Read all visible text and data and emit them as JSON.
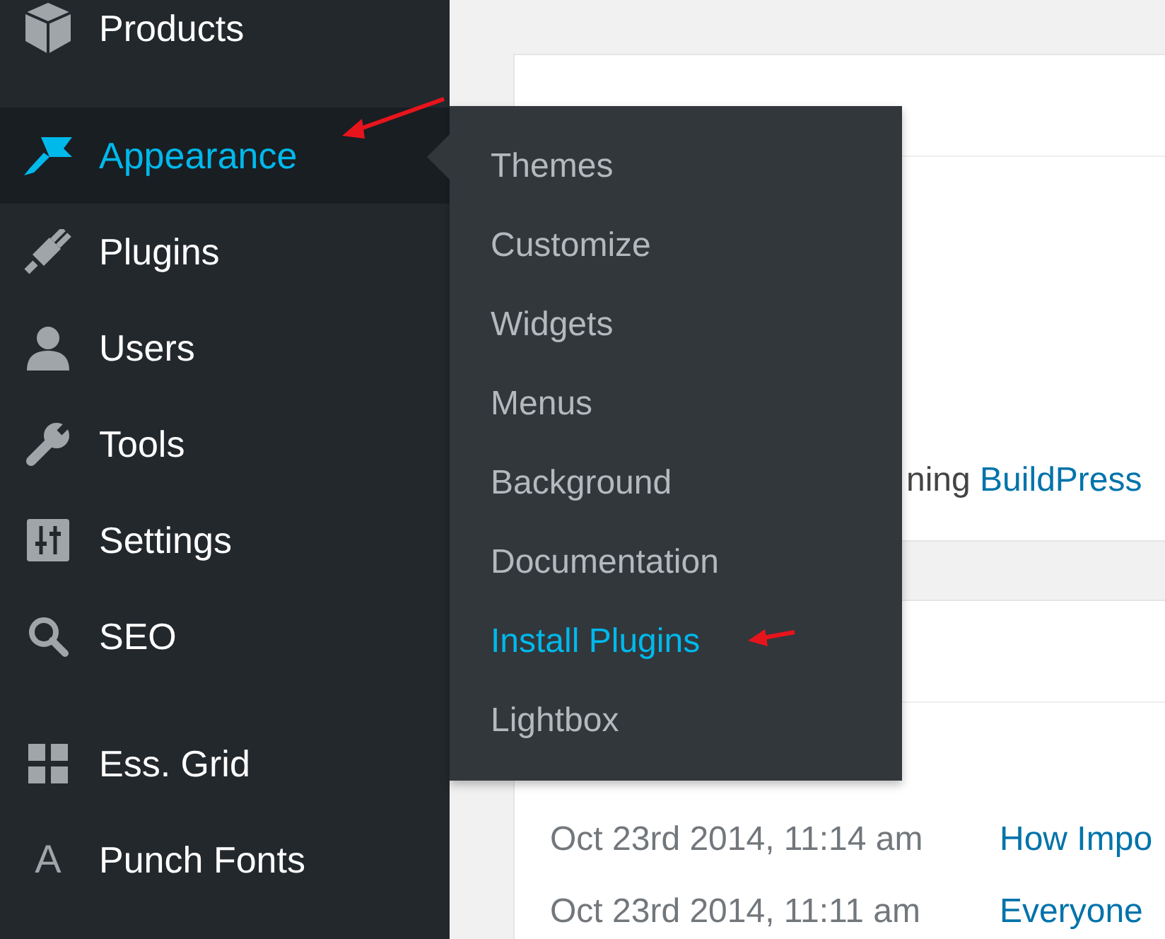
{
  "sidebar": {
    "groups": [
      {
        "items": [
          {
            "label": "Products",
            "selected": false
          }
        ]
      },
      {
        "items": [
          {
            "label": "Appearance",
            "selected": true
          },
          {
            "label": "Plugins",
            "selected": false
          },
          {
            "label": "Users",
            "selected": false
          },
          {
            "label": "Tools",
            "selected": false
          },
          {
            "label": "Settings",
            "selected": false
          },
          {
            "label": "SEO",
            "selected": false
          }
        ]
      },
      {
        "items": [
          {
            "label": "Ess. Grid",
            "selected": false
          },
          {
            "label": "Punch Fonts",
            "selected": false,
            "glyph": "A"
          }
        ]
      }
    ]
  },
  "flyout": {
    "items": [
      {
        "label": "Themes",
        "selected": false
      },
      {
        "label": "Customize",
        "selected": false
      },
      {
        "label": "Widgets",
        "selected": false
      },
      {
        "label": "Menus",
        "selected": false
      },
      {
        "label": "Background",
        "selected": false
      },
      {
        "label": "Documentation",
        "selected": false
      },
      {
        "label": "Install Plugins",
        "selected": true
      },
      {
        "label": "Lightbox",
        "selected": false
      }
    ]
  },
  "cards": [
    {
      "text": "ning",
      "link": "BuildPress"
    },
    {
      "rows": [
        {
          "date": "Oct 23rd 2014, 11:14 am",
          "link": "How Impo"
        },
        {
          "date": "Oct 23rd 2014, 11:11 am",
          "link": "Everyone"
        }
      ]
    }
  ]
}
